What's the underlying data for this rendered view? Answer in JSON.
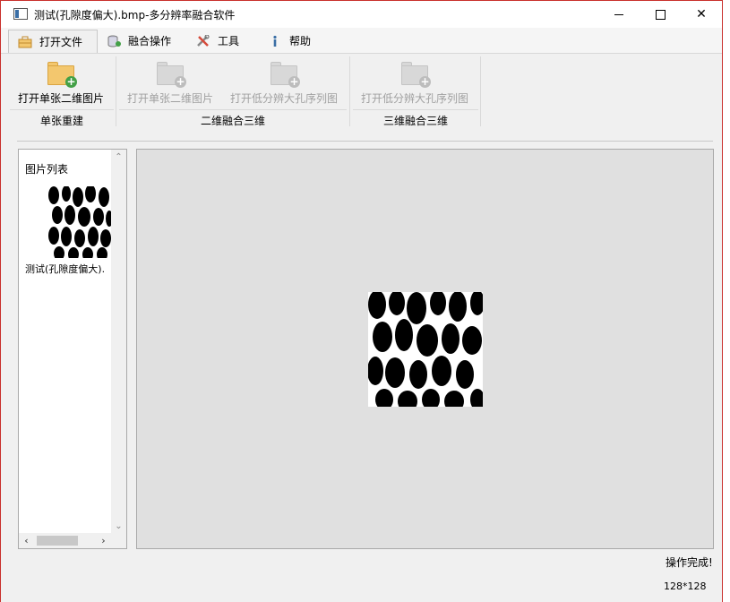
{
  "window": {
    "title": "测试(孔隙度偏大).bmp-多分辨率融合软件",
    "controls": {
      "minimize": "",
      "maximize": "",
      "close": "✕"
    }
  },
  "menu": {
    "tabs": [
      {
        "label": "打开文件",
        "icon": "briefcase-icon",
        "active": true
      },
      {
        "label": "融合操作",
        "icon": "database-icon",
        "active": false
      },
      {
        "label": "工具",
        "icon": "tools-icon",
        "active": false
      },
      {
        "label": "帮助",
        "icon": "info-icon",
        "active": false
      }
    ]
  },
  "ribbon": {
    "groups": [
      {
        "label": "单张重建",
        "buttons": [
          {
            "label": "打开单张二维图片",
            "enabled": true
          }
        ]
      },
      {
        "label": "二维融合三维",
        "buttons": [
          {
            "label": "打开单张二维图片",
            "enabled": false
          },
          {
            "label": "打开低分辨大孔序列图",
            "enabled": false
          }
        ]
      },
      {
        "label": "三维融合三维",
        "buttons": [
          {
            "label": "打开低分辨大孔序列图",
            "enabled": false
          }
        ]
      }
    ]
  },
  "image_list": {
    "title": "图片列表",
    "items": [
      {
        "caption": "测试(孔隙度偏大)."
      }
    ]
  },
  "status": {
    "message": "操作完成!",
    "image_size": "128*128"
  },
  "colors": {
    "accent_folder": "#f3c76e",
    "plus_green": "#43a047",
    "viewer_bg": "#e0e0e0",
    "window_border": "#c9302c"
  }
}
